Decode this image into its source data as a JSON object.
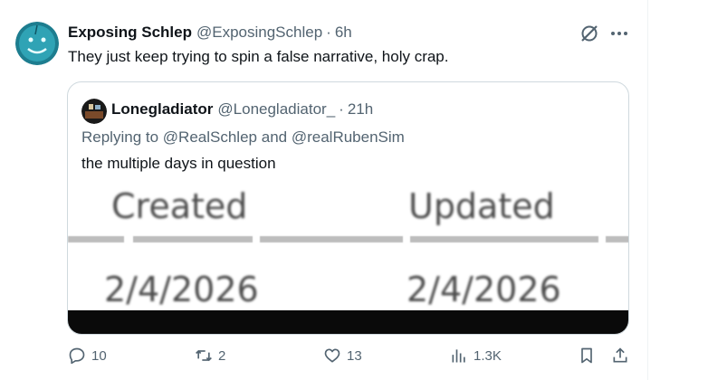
{
  "post": {
    "author_name": "Exposing Schlep",
    "handle": "@ExposingSchlep",
    "separator": "·",
    "time": "6h",
    "text": "They just keep trying to spin a false narrative, holy crap."
  },
  "quote": {
    "author_name": "Lonegladiator",
    "handle": "@Lonegladiator_",
    "separator": "·",
    "time": "21h",
    "replying_prefix": "Replying to",
    "replying_to_1": "@RealSchlep",
    "replying_and": "and",
    "replying_to_2": "@realRubenSim",
    "text": "the multiple days in question",
    "media": {
      "label_created": "Created",
      "label_updated": "Updated",
      "date_created": "2/4/2026",
      "date_updated": "2/4/2026"
    }
  },
  "actions": {
    "replies": "10",
    "reposts": "2",
    "likes": "13",
    "views": "1.3K"
  },
  "colors": {
    "text": "#0f1419",
    "muted": "#536471",
    "border": "#cfd9de",
    "avatar_bg": "#2a8fa0"
  },
  "icons": [
    "reply-icon",
    "repost-icon",
    "like-icon",
    "views-icon",
    "bookmark-icon",
    "share-icon",
    "grok-icon",
    "more-icon"
  ]
}
